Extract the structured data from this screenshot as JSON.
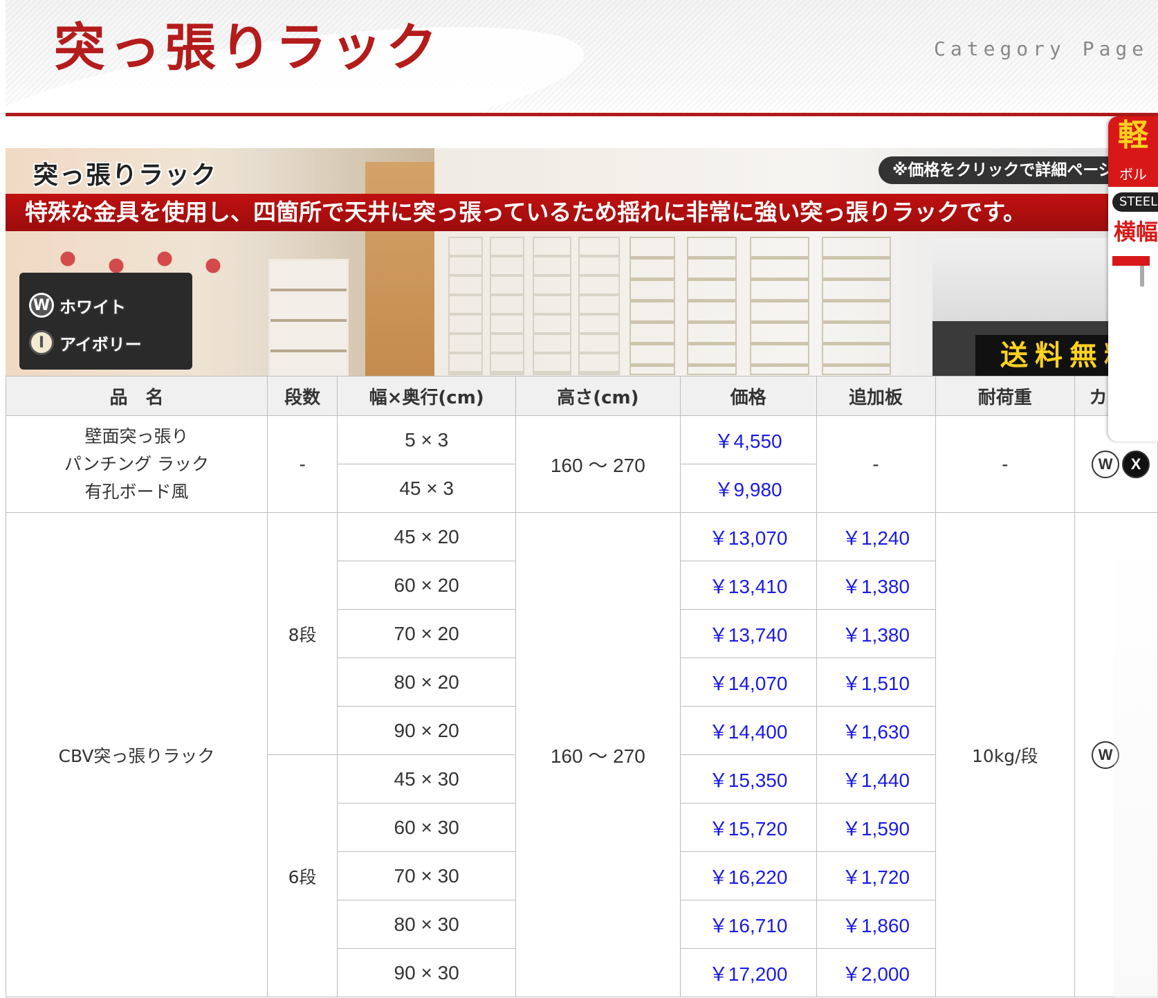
{
  "header": {
    "title": "突っ張りラック",
    "category_label": "Category Page"
  },
  "banner": {
    "title": "突っ張りラック",
    "click_note": "※価格をクリックで詳細ページへ",
    "tagline": "特殊な金具を使用し、四箇所で天井に突っ張っているため揺れに非常に強い突っ張りラックです。",
    "colors": [
      {
        "badge": "W",
        "name": "ホワイト"
      },
      {
        "badge": "I",
        "name": "アイボリー"
      }
    ],
    "shipping": "送料無料",
    "promo": {
      "top": "軽",
      "sub": "ボル",
      "steel": "STEEL",
      "wide": "横幅"
    }
  },
  "table": {
    "headers": [
      "品　名",
      "段数",
      "幅×奥行(cm)",
      "高さ(cm)",
      "価格",
      "追加板",
      "耐荷重",
      "カラー"
    ],
    "group1": {
      "product_lines": [
        "壁面突っ張り",
        "パンチング ラック",
        "有孔ボード風"
      ],
      "tiers": "-",
      "height": "160 〜 270",
      "extra": "-",
      "load": "-",
      "colors": [
        "W",
        "X"
      ],
      "rows": [
        {
          "size": "5 × 3",
          "price": "￥4,550"
        },
        {
          "size": "45 × 3",
          "price": "￥9,980"
        }
      ]
    },
    "group2": {
      "product": "CBV突っ張りラック",
      "height": "160 〜 270",
      "load": "10kg/段",
      "colors": [
        "W"
      ],
      "tier_8": "8段",
      "tier_6": "6段",
      "rows": [
        {
          "size": "45 × 20",
          "price": "￥13,070",
          "extra": "￥1,240"
        },
        {
          "size": "60 × 20",
          "price": "￥13,410",
          "extra": "￥1,380"
        },
        {
          "size": "70 × 20",
          "price": "￥13,740",
          "extra": "￥1,380"
        },
        {
          "size": "80 × 20",
          "price": "￥14,070",
          "extra": "￥1,510"
        },
        {
          "size": "90 × 20",
          "price": "￥14,400",
          "extra": "￥1,630"
        },
        {
          "size": "45 × 30",
          "price": "￥15,350",
          "extra": "￥1,440"
        },
        {
          "size": "60 × 30",
          "price": "￥15,720",
          "extra": "￥1,590"
        },
        {
          "size": "70 × 30",
          "price": "￥16,220",
          "extra": "￥1,720"
        },
        {
          "size": "80 × 30",
          "price": "￥16,710",
          "extra": "￥1,860"
        },
        {
          "size": "90 × 30",
          "price": "￥17,200",
          "extra": "￥2,000"
        }
      ]
    }
  },
  "colors": {
    "brand_red": "#b41b1b",
    "link_blue": "#1a1ae6"
  }
}
